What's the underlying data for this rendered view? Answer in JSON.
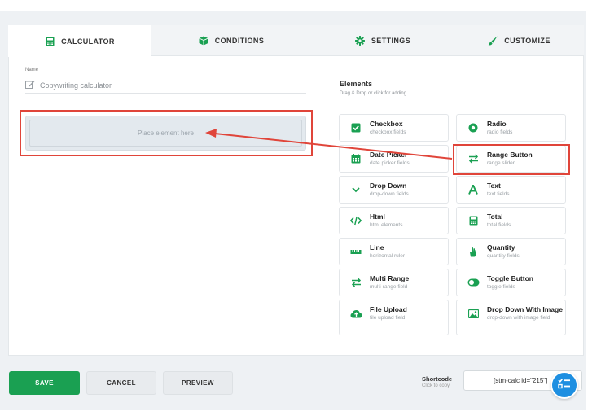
{
  "tabs": [
    {
      "label": "CALCULATOR",
      "icon": "calculator-icon",
      "active": true
    },
    {
      "label": "CONDITIONS",
      "icon": "cube-icon"
    },
    {
      "label": "SETTINGS",
      "icon": "gear-icon"
    },
    {
      "label": "CUSTOMIZE",
      "icon": "brush-icon"
    }
  ],
  "name_field": {
    "label": "Name",
    "value": "Copywriting calculator"
  },
  "drop_zone": {
    "placeholder": "Place element here"
  },
  "elements": {
    "title": "Elements",
    "subtitle": "Drag & Drop or click for adding",
    "items": [
      {
        "name": "Checkbox",
        "desc": "checkbox fields",
        "icon": "checkbox-icon"
      },
      {
        "name": "Radio",
        "desc": "radio fields",
        "icon": "radio-icon"
      },
      {
        "name": "Date Picker",
        "desc": "date picker fields",
        "icon": "calendar-icon"
      },
      {
        "name": "Range Button",
        "desc": "range slider",
        "icon": "range-arrows-icon"
      },
      {
        "name": "Drop Down",
        "desc": "drop-down fields",
        "icon": "chevron-down-icon"
      },
      {
        "name": "Text",
        "desc": "text fields",
        "icon": "text-icon"
      },
      {
        "name": "Html",
        "desc": "html elements",
        "icon": "code-icon"
      },
      {
        "name": "Total",
        "desc": "total fields",
        "icon": "calculator-icon"
      },
      {
        "name": "Line",
        "desc": "horizontal ruler",
        "icon": "ruler-icon"
      },
      {
        "name": "Quantity",
        "desc": "quantity fields",
        "icon": "hand-icon"
      },
      {
        "name": "Multi Range",
        "desc": "multi-range field",
        "icon": "multi-range-icon"
      },
      {
        "name": "Toggle Button",
        "desc": "toggle fields",
        "icon": "toggle-icon"
      },
      {
        "name": "File Upload",
        "desc": "file upload field",
        "icon": "cloud-upload-icon"
      },
      {
        "name": "Drop Down With Image",
        "desc": "drop-down with image field",
        "icon": "image-icon"
      }
    ]
  },
  "footer": {
    "save": "SAVE",
    "cancel": "CANCEL",
    "preview": "PREVIEW",
    "shortcode_title": "Shortcode",
    "shortcode_sub": "Click to copy",
    "shortcode_value": "[stm-calc id=\"215\"]"
  },
  "colors": {
    "accent": "#1aa052",
    "highlight": "#e0453a",
    "fab": "#1e8fe1"
  }
}
